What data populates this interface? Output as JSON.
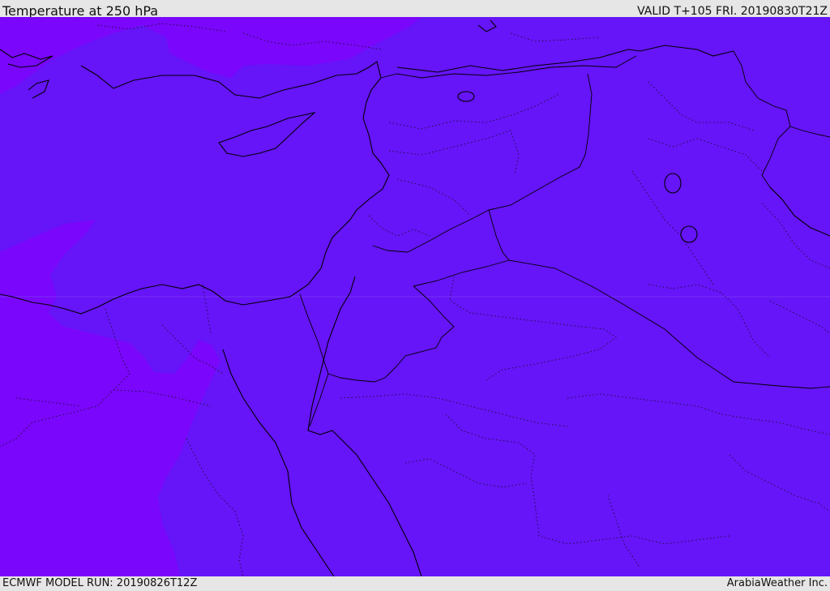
{
  "header": {
    "title": "Temperature at 250 hPa",
    "valid_time": "VALID T+105 FRI. 20190830T21Z"
  },
  "footer": {
    "model_run": "ECMWF MODEL RUN: 20190826T12Z",
    "credit": "ArabiaWeather Inc."
  },
  "map": {
    "region": "Eastern Mediterranean and Middle East",
    "field": "temperature",
    "level_hPa": 250,
    "colors": {
      "main_fill": "#6614f8",
      "cold_fill": "#7a06fb",
      "coastline": "#000000",
      "border": "#000000",
      "province_border": "#111111",
      "frame_bg": "#e6e6e6"
    },
    "lines": {
      "country_borders": "solid",
      "province_borders": "dotted"
    }
  }
}
